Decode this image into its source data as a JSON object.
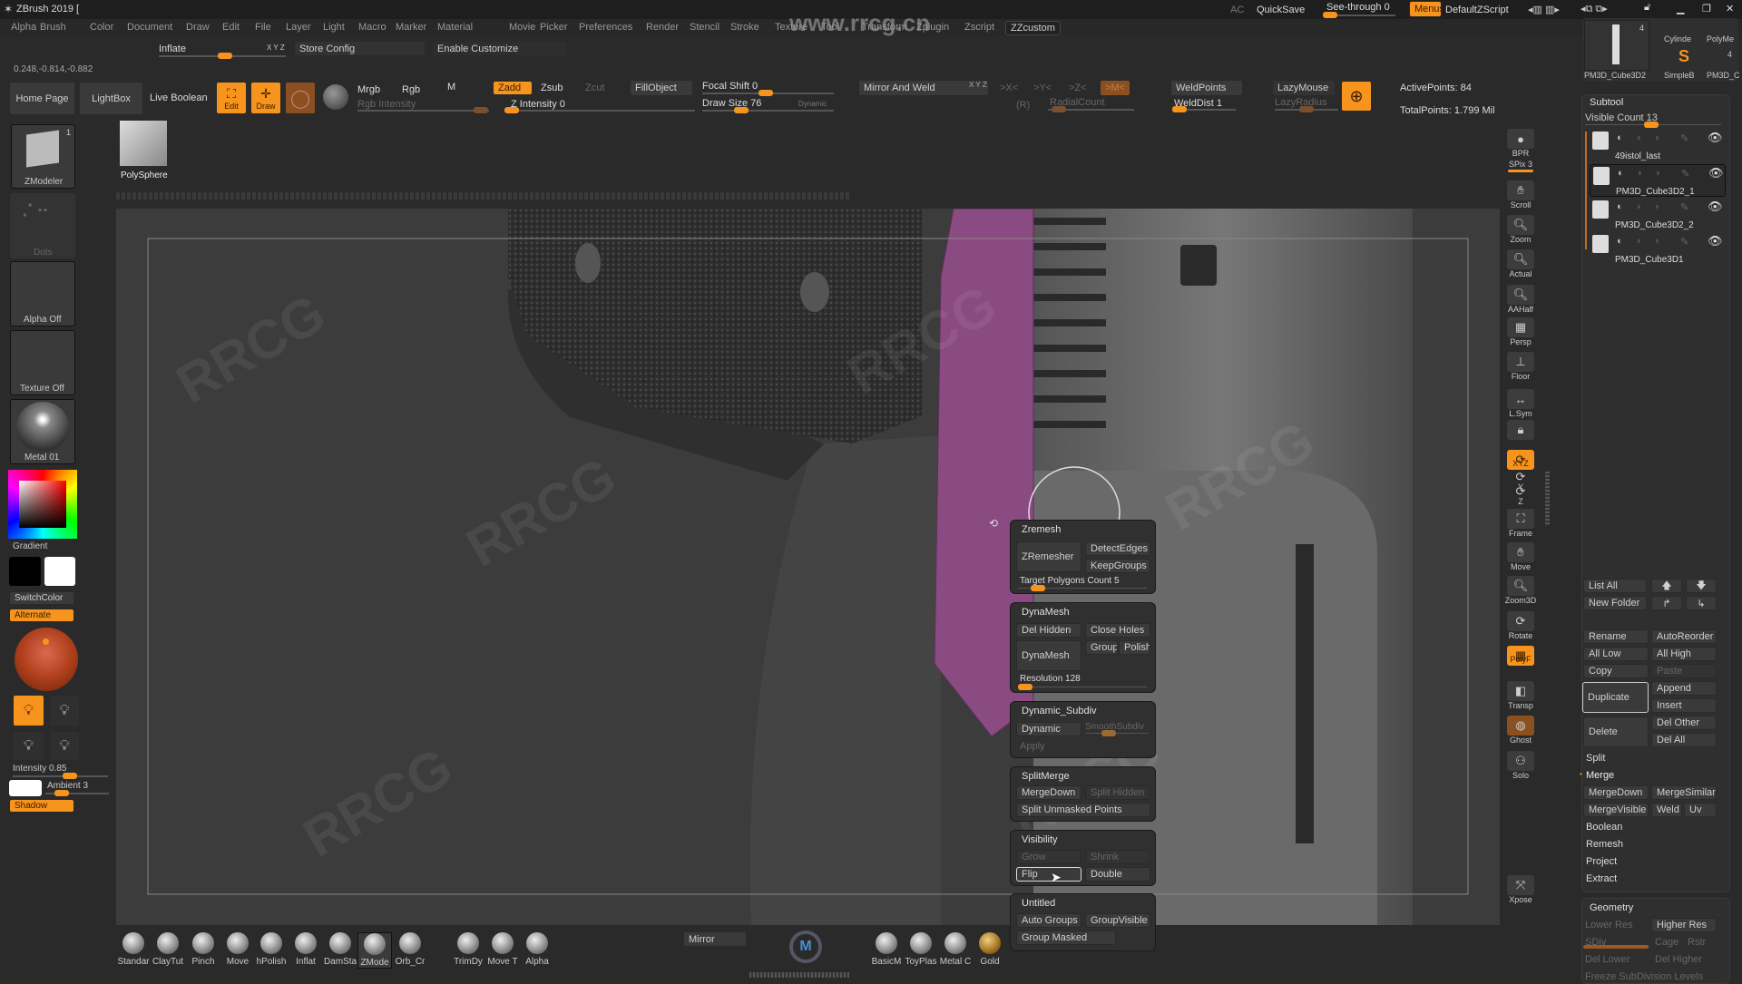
{
  "app": {
    "title": "ZBrush 2019 [",
    "watermark": "www.rrcg.cn",
    "watermark_mark": "RRCG",
    "coords": "0.248,-0.814,-0.882"
  },
  "titlebar": {
    "ac": "AC",
    "quicksave": "QuickSave",
    "seethrough": "See-through  0",
    "seethrough_value": 0,
    "menus": "Menus",
    "script": "DefaultZScript"
  },
  "menus": [
    "Alpha",
    "Brush",
    "Color",
    "Document",
    "Draw",
    "Edit",
    "File",
    "Layer",
    "Light",
    "Macro",
    "Marker",
    "Material",
    "Movie",
    "Picker",
    "Preferences",
    "Render",
    "Stencil",
    "Stroke",
    "Texture",
    "Tool",
    "Transform",
    "Zplugin",
    "Zscript",
    "ZZcustom"
  ],
  "row2": {
    "inflate": "Inflate",
    "xyz": "X Y Z",
    "store_config": "Store Config",
    "enable_customize": "Enable Customize"
  },
  "toolbar": {
    "home": "Home Page",
    "lightbox": "LightBox",
    "live_boolean": "Live Boolean",
    "edit": "Edit",
    "draw": "Draw",
    "mrgb": "Mrgb",
    "rgb": "Rgb",
    "m": "M",
    "zadd": "Zadd",
    "zsub": "Zsub",
    "zcut": "Zcut",
    "rgb_intensity": "Rgb Intensity",
    "z_intensity": "Z Intensity 0",
    "fillobject": "FillObject",
    "focal_shift": "Focal Shift 0",
    "draw_size": "Draw Size 76",
    "dynamic": "Dynamic",
    "mirror_weld": "Mirror And Weld",
    "mirror_xyz": "X Y Z",
    "x": ">X<",
    "y": ">Y<",
    "z": ">Z<",
    "mm": ">M<",
    "r": "(R)",
    "radial": "RadialCount",
    "weldpoints": "WeldPoints",
    "welddist": "WeldDist 1",
    "lazymouse": "LazyMouse",
    "lazyradius": "LazyRadius",
    "active_points": "ActivePoints: 84",
    "total_points": "TotalPoints: 1.799 Mil"
  },
  "left": {
    "zmodeler": "ZModeler",
    "zmodeler_count": "1",
    "polysphere": "PolySphere",
    "dots": "Dots",
    "alpha": "Alpha Off",
    "texture": "Texture Off",
    "material": "Metal 01",
    "gradient": "Gradient",
    "switchcolor": "SwitchColor",
    "alternate": "Alternate",
    "intensity": "Intensity 0.85",
    "ambient": "Ambient 3",
    "shadow": "Shadow"
  },
  "tool_thumbs": {
    "t1": "PM3D_Cube3D2",
    "t1_count": "4",
    "t2": "Cylinde",
    "t3": "PolyMe",
    "t4": "SimpleB",
    "t5": "PM3D_C",
    "t5_count": "4"
  },
  "subtool": {
    "title": "Subtool",
    "visible_count": "Visible Count 13",
    "items": [
      "49istol_last",
      "PM3D_Cube3D2_1",
      "PM3D_Cube3D2_2",
      "PM3D_Cube3D1"
    ],
    "selected": 1
  },
  "subtool_buttons": {
    "list_all": "List All",
    "new_folder": "New Folder",
    "rename": "Rename",
    "autoreorder": "AutoReorder",
    "all_low": "All Low",
    "all_high": "All High",
    "copy": "Copy",
    "paste": "Paste",
    "duplicate": "Duplicate",
    "append": "Append",
    "insert": "Insert",
    "delete": "Delete",
    "del_other": "Del Other",
    "del_all": "Del All",
    "split": "Split",
    "merge": "Merge",
    "mergedown": "MergeDown",
    "mergesimilar": "MergeSimilar",
    "mergevisible": "MergeVisible",
    "weld": "Weld",
    "uv": "Uv",
    "boolean": "Boolean",
    "remesh": "Remesh",
    "project": "Project",
    "extract": "Extract"
  },
  "geometry": {
    "title": "Geometry",
    "lower_res": "Lower Res",
    "higher_res": "Higher Res",
    "sdiv": "SDiv",
    "cage": "Cage",
    "rstr": "Rstr",
    "del_lower": "Del Lower",
    "del_higher": "Del Higher",
    "freeze": "Freeze SubDivision Levels"
  },
  "right_shelf": [
    {
      "label": "BPR",
      "icon": "sphere"
    },
    {
      "label": "SPix 3",
      "icon": "slider"
    },
    {
      "label": "Scroll",
      "icon": "hand"
    },
    {
      "label": "Zoom",
      "icon": "magnifier"
    },
    {
      "label": "Actual",
      "icon": "magnifier"
    },
    {
      "label": "AAHalf",
      "icon": "magnifier"
    },
    {
      "label": "Persp",
      "icon": "grid"
    },
    {
      "label": "Floor",
      "icon": "floor"
    },
    {
      "label": "L.Sym",
      "icon": "arrows"
    },
    {
      "label": "",
      "icon": "lock"
    },
    {
      "label": "XYZ",
      "icon": "rotate",
      "active": true
    },
    {
      "label": "Y",
      "icon": "rotate"
    },
    {
      "label": "Z",
      "icon": "rotate"
    },
    {
      "label": "Frame",
      "icon": "frame"
    },
    {
      "label": "Move",
      "icon": "hand"
    },
    {
      "label": "Zoom3D",
      "icon": "magnifier"
    },
    {
      "label": "Rotate",
      "icon": "rotate"
    },
    {
      "label": "PolyF",
      "icon": "grid",
      "active": true
    },
    {
      "label": "Transp",
      "icon": "cube"
    },
    {
      "label": "Ghost",
      "icon": "ghost",
      "dim_active": true
    },
    {
      "label": "Solo",
      "icon": "spheres"
    },
    {
      "label": "Xpose",
      "icon": "expand"
    }
  ],
  "popup": {
    "zremesh": {
      "title": "Zremesh",
      "zremesher": "ZRemesher",
      "detectedges": "DetectEdges",
      "keepgroups": "KeepGroups",
      "target": "Target Polygons Count 5",
      "target_value": 5
    },
    "dynamesh": {
      "title": "DynaMesh",
      "del_hidden": "Del Hidden",
      "close_holes": "Close Holes",
      "groups": "Groups",
      "polish": "Polish",
      "dynamesh": "DynaMesh",
      "resolution": "Resolution 128",
      "resolution_value": 128
    },
    "dynsub": {
      "title": "Dynamic_Subdiv",
      "dynamic": "Dynamic",
      "smooth": "SmoothSubdiv",
      "apply": "Apply"
    },
    "splitmerge": {
      "title": "SplitMerge",
      "mergedown": "MergeDown",
      "split_hidden": "Split Hidden",
      "split_unmasked": "Split Unmasked Points"
    },
    "visibility": {
      "title": "Visibility",
      "grow": "Grow",
      "shrink": "Shrink",
      "flip": "Flip",
      "double": "Double"
    },
    "untitled": {
      "title": "Untitled",
      "auto_groups": "Auto Groups",
      "groupvisible": "GroupVisible",
      "group_masked": "Group Masked"
    }
  },
  "brushes": [
    "Standar",
    "ClayTut",
    "Pinch",
    "Move",
    "hPolish",
    "Inflat",
    "DamSta",
    "ZMode",
    "Orb_Cr",
    "TrimDy",
    "Move T",
    "Alpha"
  ],
  "bottom": {
    "mirror": "Mirror",
    "materials": [
      "BasicM",
      "ToyPlas",
      "Metal C",
      "Gold"
    ]
  },
  "colors": {
    "accent": "#f7941d",
    "mesh_highlight": "#8a4a82",
    "bg": "#2a2a2a"
  }
}
